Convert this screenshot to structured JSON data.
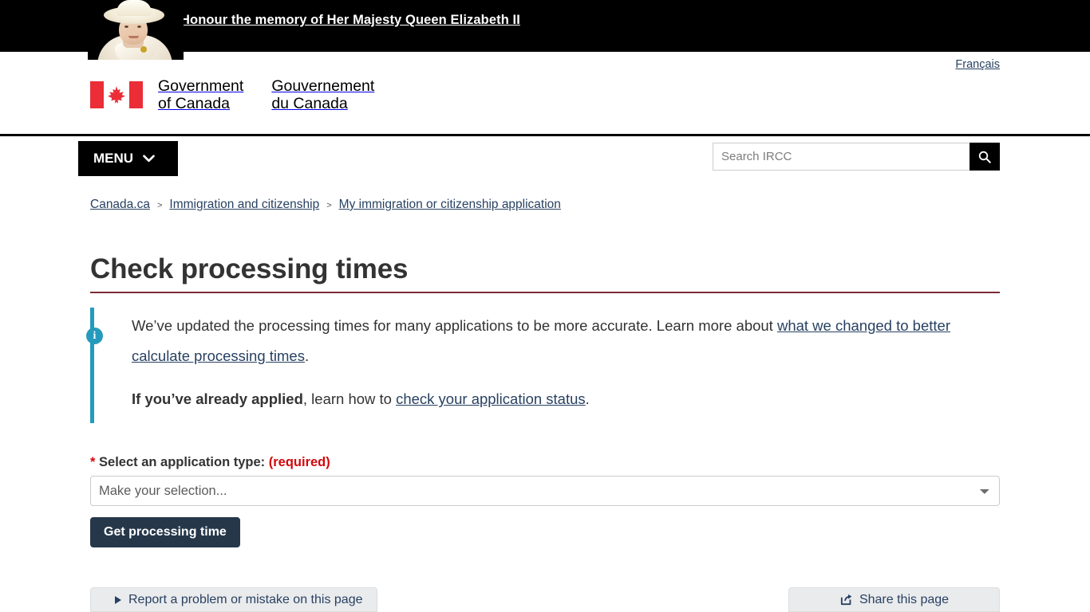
{
  "mourning_banner": {
    "link_text": "Honour the memory of Her Majesty Queen Elizabeth II",
    "portrait_alt": "queen-elizabeth-portrait"
  },
  "header": {
    "language_toggle": "Français",
    "wordmark_en_line1": "Government",
    "wordmark_en_line2": "of Canada",
    "wordmark_fr_line1": "Gouvernement",
    "wordmark_fr_line2": "du Canada",
    "search": {
      "placeholder": "Search IRCC",
      "value": "",
      "button_icon": "search-icon"
    }
  },
  "menu": {
    "label": "MENU",
    "chevron": "chevron-down-icon"
  },
  "breadcrumb": {
    "separator": ">",
    "items": [
      {
        "label": "Canada.ca"
      },
      {
        "label": "Immigration and citizenship"
      },
      {
        "label": "My immigration or citizenship application"
      }
    ]
  },
  "main": {
    "page_title": "Check processing times",
    "alert": {
      "icon": "info-icon",
      "paragraph1_part1": "We’ve updated the processing times for many applications to be more accurate. Learn more about ",
      "paragraph1_link": "what we changed to better calculate processing times",
      "paragraph1_part2": ".",
      "paragraph2_bold": "If you’ve already applied",
      "paragraph2_mid": ", learn how to ",
      "paragraph2_link": "check your application status",
      "paragraph2_end": "."
    },
    "form": {
      "required_star": "*",
      "label": "Select an application type:",
      "required_note": "(required)",
      "select_value": "Make your selection...",
      "select_options": [
        "Make your selection..."
      ],
      "submit_label": "Get processing time"
    }
  },
  "feedback": {
    "report_label": "Report a problem or mistake on this page",
    "report_toggle_icon": "triangle-right-icon",
    "share_label": "Share this page",
    "share_icon": "share-external-icon"
  },
  "colors": {
    "flag_red": "#ea2d37",
    "title_rule": "#7b2c37",
    "alert_accent": "#269abc",
    "link": "#284162",
    "required": "#d3080c",
    "button_primary": "#26374a",
    "feedback_bg": "#eaebed"
  }
}
